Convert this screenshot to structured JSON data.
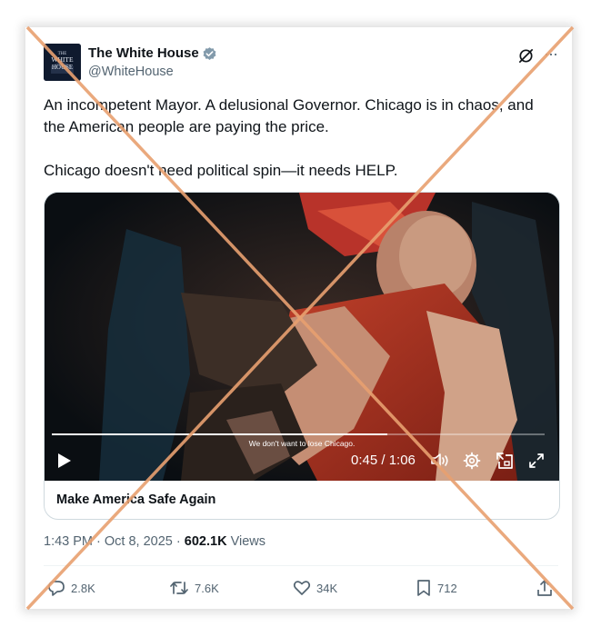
{
  "author": {
    "name": "The White House",
    "handle": "@WhiteHouse",
    "avatar_text": [
      "THE",
      "WHITE",
      "HOUSE"
    ],
    "verified_color": "#829aab"
  },
  "tweet": {
    "paragraphs": [
      "An incompetent Mayor. A delusional Governor. Chicago is in chaos, and the American people are paying the price.",
      "Chicago doesn't need political spin—it needs HELP."
    ]
  },
  "video": {
    "caption": "We don't want to lose Chicago.",
    "time": "0:45 / 1:06",
    "progress": 0.68,
    "title": "Make America Safe Again"
  },
  "meta": {
    "time": "1:43 PM",
    "separator": "·",
    "date": "Oct 8, 2025",
    "views_count": "602.1K",
    "views_label": "Views"
  },
  "actions": {
    "replies": "2.8K",
    "reposts": "7.6K",
    "likes": "34K",
    "bookmarks": "712"
  },
  "icons": {
    "more": "···"
  },
  "colors": {
    "overlay_cross": "#e8a070",
    "text_primary": "#0f1419",
    "text_secondary": "#536471"
  }
}
